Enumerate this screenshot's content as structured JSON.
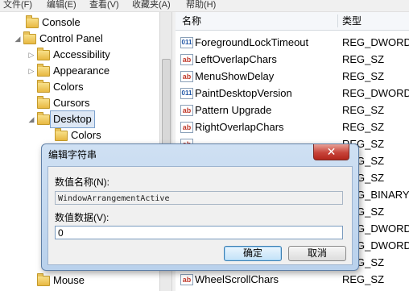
{
  "menubar": {
    "items": [
      "文件(F)",
      "编辑(E)",
      "查看(V)",
      "收藏夹(A)",
      "帮助(H)"
    ]
  },
  "tree": {
    "items": [
      {
        "label": "Console",
        "expander": ""
      },
      {
        "label": "Control Panel",
        "expander": "◢"
      },
      {
        "label": "Accessibility",
        "expander": "▷"
      },
      {
        "label": "Appearance",
        "expander": "▷"
      },
      {
        "label": "Colors",
        "expander": ""
      },
      {
        "label": "Cursors",
        "expander": ""
      },
      {
        "label": "Desktop",
        "expander": "◢"
      },
      {
        "label": "Colors",
        "expander": ""
      },
      {
        "label": "Mouse",
        "expander": ""
      }
    ],
    "selected": "Desktop"
  },
  "values": {
    "col_name": "名称",
    "col_type": "类型",
    "rows": [
      {
        "name": "ForegroundLockTimeout",
        "type": "REG_DWORD",
        "icon": "dword-value-icon"
      },
      {
        "name": "LeftOverlapChars",
        "type": "REG_SZ",
        "icon": "string-value-icon"
      },
      {
        "name": "MenuShowDelay",
        "type": "REG_SZ",
        "icon": "string-value-icon"
      },
      {
        "name": "PaintDesktopVersion",
        "type": "REG_DWORD",
        "icon": "dword-value-icon"
      },
      {
        "name": "Pattern Upgrade",
        "type": "REG_SZ",
        "icon": "string-value-icon"
      },
      {
        "name": "RightOverlapChars",
        "type": "REG_SZ",
        "icon": "string-value-icon"
      },
      {
        "name": "",
        "type": "REG_SZ",
        "icon": "string-value-icon"
      },
      {
        "name": "",
        "type": "REG_SZ",
        "icon": "string-value-icon"
      },
      {
        "name": "",
        "type": "REG_SZ",
        "icon": "string-value-icon"
      },
      {
        "name": "",
        "type": "REG_BINARY",
        "icon": "binary-value-icon"
      },
      {
        "name": "",
        "type": "REG_SZ",
        "icon": "string-value-icon"
      },
      {
        "name": "",
        "type": "REG_DWORD",
        "icon": "dword-value-icon"
      },
      {
        "name": "",
        "type": "REG_DWORD",
        "icon": "dword-value-icon"
      },
      {
        "name": "",
        "type": "REG_SZ",
        "icon": "string-value-icon"
      },
      {
        "name": "WheelScrollChars",
        "type": "REG_SZ",
        "icon": "string-value-icon"
      }
    ]
  },
  "dialog": {
    "title": "编辑字符串",
    "close_glyph": "✕",
    "name_label": "数值名称(N):",
    "name_value": "WindowArrangementActive",
    "data_label": "数值数据(V):",
    "data_value": "0",
    "ok_label": "确定",
    "cancel_label": "取消"
  },
  "colors": {
    "selection": "#dde7f4",
    "dialog_frame": "#b9d1ec",
    "close_button": "#c7443a"
  }
}
